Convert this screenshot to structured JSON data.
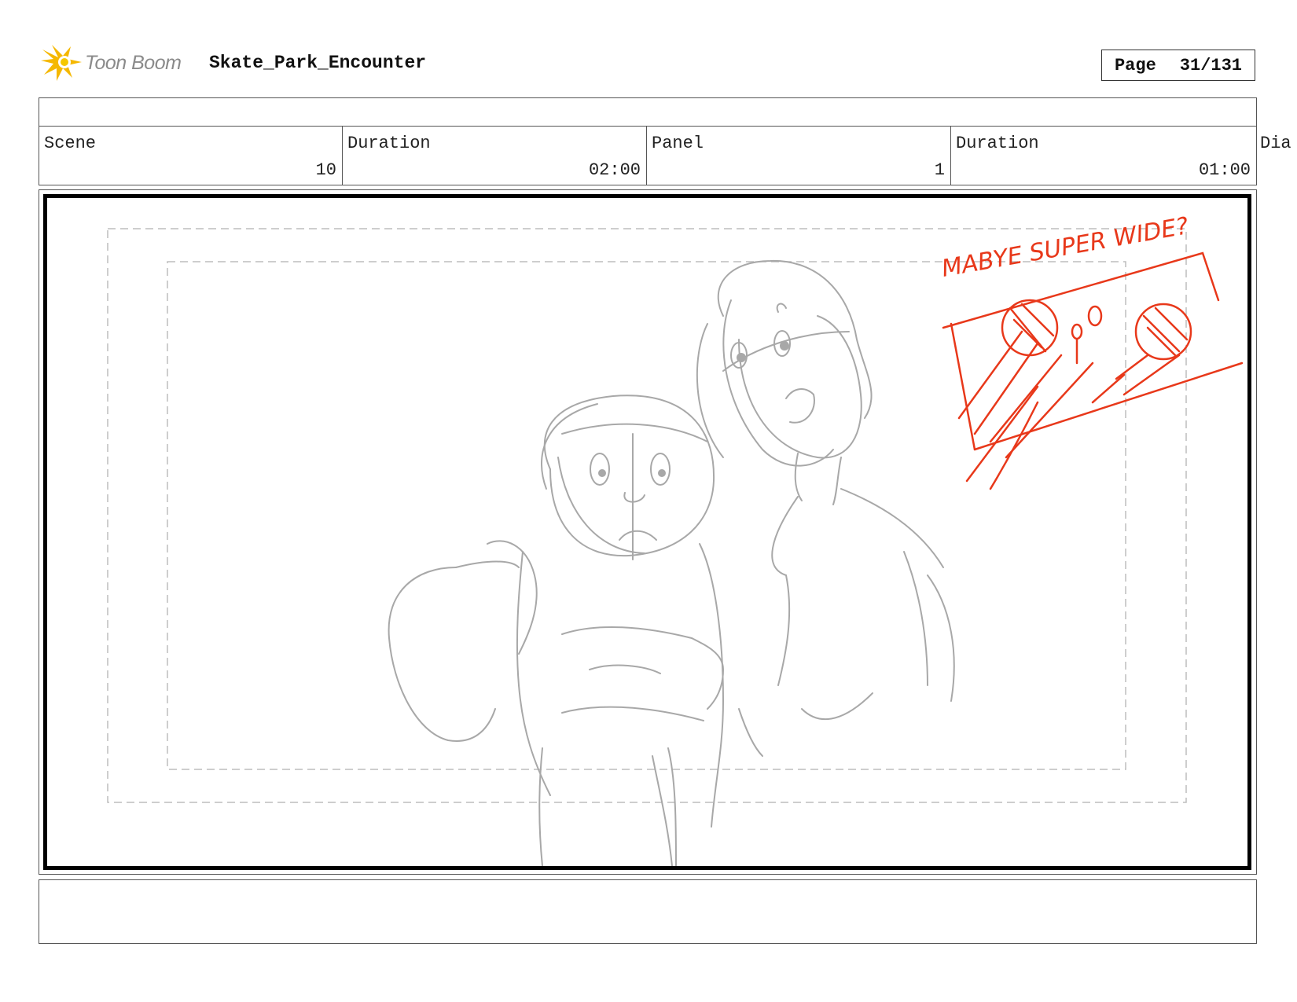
{
  "header": {
    "logo_text": "Toon Boom",
    "logo_icon": "starburst-icon",
    "project_title": "Skate_Park_Encounter",
    "page_label": "Page",
    "page_value": "31/131"
  },
  "info": {
    "scene_label": "Scene",
    "scene_value": "10",
    "scene_duration_label": "Duration",
    "scene_duration_value": "02:00",
    "panel_label": "Panel",
    "panel_value": "1",
    "panel_duration_label": "Duration",
    "panel_duration_value": "01:00",
    "dialogue_label_partial": "Dia"
  },
  "panel": {
    "annotation_text": "MABYE SUPER WIDE?",
    "sketch_color": "#a8a8a8",
    "annotation_color": "#e8381a",
    "frame_color": "#000000",
    "safe_area_color": "#bdbdbd"
  },
  "colors": {
    "logo_yellow": "#f5b800",
    "logo_text_gray": "#8a8a8a"
  }
}
